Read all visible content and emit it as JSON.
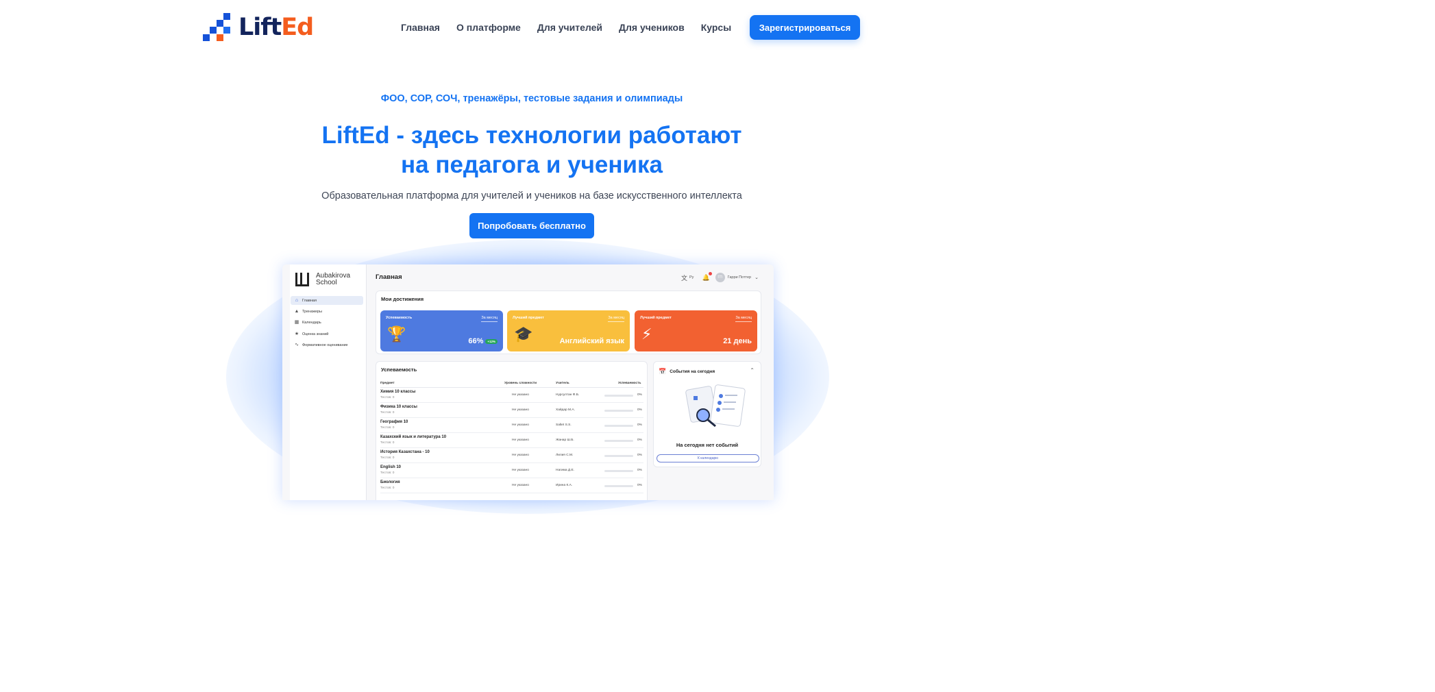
{
  "brand": {
    "name_part1": "Lift",
    "name_part2": "Ed",
    "colors": {
      "dark": "#13245c",
      "orange": "#f45d1e",
      "blue": "#1473f2"
    }
  },
  "nav": {
    "items": [
      "Главная",
      "О платформе",
      "Для учителей",
      "Для учеников",
      "Курсы"
    ],
    "signup_label": "Зарегистрироваться"
  },
  "hero": {
    "tagline": "ФОО, СОР, СОЧ, тренажёры, тестовые задания и олимпиады",
    "title_line1": "LiftEd - здесь технологии работают",
    "title_line2": "на педагога и ученика",
    "subtitle": "Образовательная платформа для учителей и учеников на базе искусственного интеллекта",
    "cta_label": "Попробовать бесплатно"
  },
  "preview": {
    "school_line1": "Aubakirova",
    "school_line2": "School",
    "sidebar": [
      {
        "label": "Главная",
        "icon": "home-icon"
      },
      {
        "label": "Тренажеры",
        "icon": "graduation-cap-icon"
      },
      {
        "label": "Календарь",
        "icon": "calendar-icon"
      },
      {
        "label": "Оценка знаний",
        "icon": "star-icon"
      },
      {
        "label": "Формативное оценивание",
        "icon": "chart-line-icon"
      }
    ],
    "page_title": "Главная",
    "lang": "Ру",
    "avatar_initials": "ГП",
    "user_name": "Гарри Поттер",
    "achievements": {
      "title": "Мои достижения",
      "tiles": [
        {
          "label": "Успеваемость",
          "period": "За месяц",
          "value": "66%",
          "badge": "+12%",
          "color": "#4e7ae0"
        },
        {
          "label": "Лучший предмет",
          "period": "За месяц",
          "value": "Английский язык",
          "color": "#f9bf3d"
        },
        {
          "label": "Лучший предмет",
          "period": "За месяц",
          "value": "21 день",
          "color": "#f26131"
        }
      ]
    },
    "performance": {
      "title": "Успеваемость",
      "headers": [
        "Предмет",
        "Уровень сложности",
        "Учитель",
        "Успеваемость"
      ],
      "rows": [
        {
          "subject": "Химия 10 классы",
          "tests": "Тестов: 0",
          "level": "Не указано",
          "teacher": "Нурсултан Ф.Б.",
          "percent": "0%"
        },
        {
          "subject": "Физика 10 классы",
          "tests": "Тестов: 0",
          "level": "Не указано",
          "teacher": "Хайдар М.А.",
          "percent": "0%"
        },
        {
          "subject": "География 10",
          "tests": "Тестов: 0",
          "level": "Не указано",
          "teacher": "Saltet S.S.",
          "percent": "0%"
        },
        {
          "subject": "Казахский язык и литература 10",
          "tests": "Тестов: 0",
          "level": "Не указано",
          "teacher": "Жанар Ш.Б.",
          "percent": "0%"
        },
        {
          "subject": "История Казахстана - 10",
          "tests": "Тестов: 0",
          "level": "Не указано",
          "teacher": "Лилия С.М.",
          "percent": "0%"
        },
        {
          "subject": "English 10",
          "tests": "Тестов: 0",
          "level": "Не указано",
          "teacher": "Нагима Д.Е.",
          "percent": "0%"
        },
        {
          "subject": "Биология",
          "tests": "Тестов: 0",
          "level": "Не указано",
          "teacher": "Ирина К.А.",
          "percent": "0%"
        }
      ]
    },
    "events": {
      "title": "События на сегодня",
      "empty_text": "На сегодня нет событий",
      "button_label": "К календарю"
    }
  }
}
